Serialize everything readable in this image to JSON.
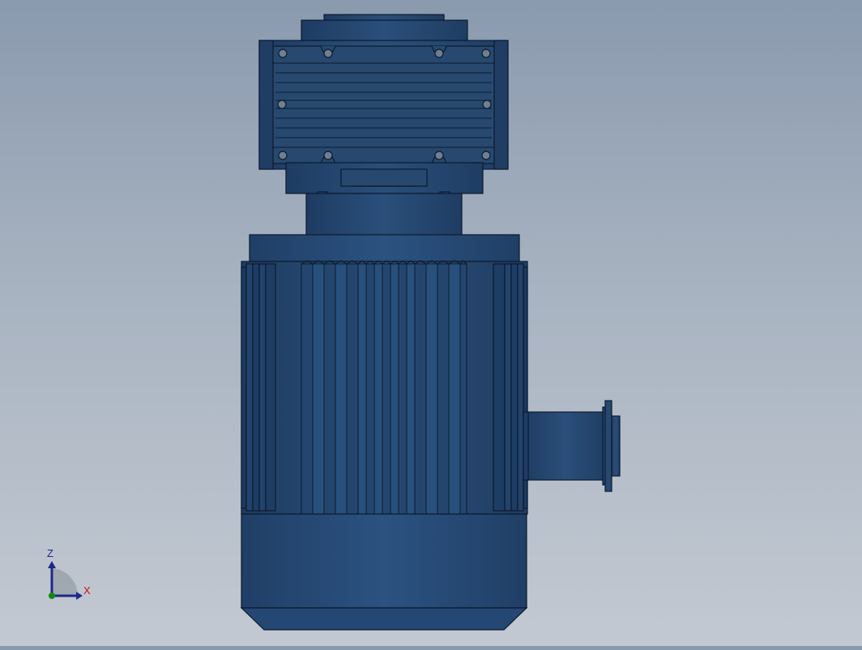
{
  "viewport": {
    "background_top": "#8a9aae",
    "background_bottom": "#c3c9d2",
    "model_color": "#24466e",
    "edge_color": "#0c1a2e"
  },
  "triad": {
    "z_label": "Z",
    "x_label": "X",
    "z_color": "#1c2a8a",
    "x_color": "#cc1111",
    "y_color": "#118811"
  }
}
